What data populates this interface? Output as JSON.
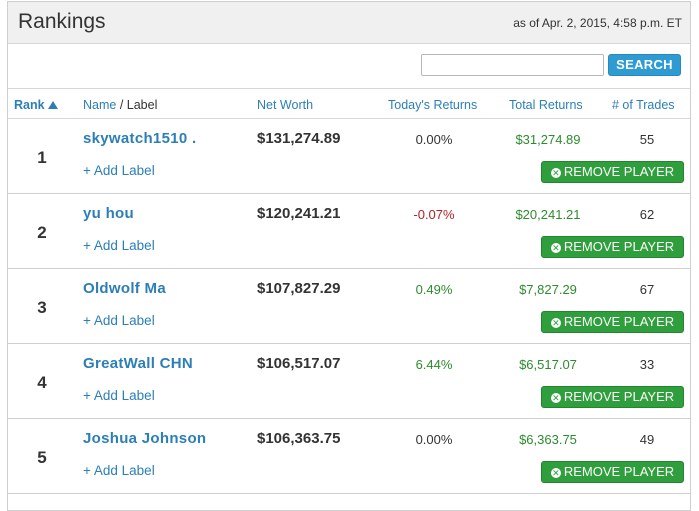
{
  "header": {
    "title": "Rankings",
    "as_of": "as of Apr. 2, 2015, 4:58 p.m. ET"
  },
  "search": {
    "placeholder": "",
    "value": "",
    "button_label": "SEARCH"
  },
  "columns": {
    "rank": "Rank",
    "name": "Name",
    "name_sep": " / ",
    "label": "Label",
    "net_worth": "Net Worth",
    "todays_returns": "Today's Returns",
    "total_returns": "Total Returns",
    "trades": "# of Trades"
  },
  "colors": {
    "link": "#2c7fb6",
    "positive": "#2e8b2e",
    "negative": "#b22222",
    "neutral": "#333333",
    "search_button": "#2e9bd3",
    "remove_button": "#2f9e3c"
  },
  "add_label_text": "+ Add Label",
  "remove_label": "REMOVE PLAYER",
  "rows": [
    {
      "rank": "1",
      "name": "skywatch1510 .",
      "net_worth": "$131,274.89",
      "today": "0.00%",
      "today_sign": "neutral",
      "total": "$31,274.89",
      "trades": "55"
    },
    {
      "rank": "2",
      "name": "yu hou",
      "net_worth": "$120,241.21",
      "today": "-0.07%",
      "today_sign": "negative",
      "total": "$20,241.21",
      "trades": "62"
    },
    {
      "rank": "3",
      "name": "Oldwolf Ma",
      "net_worth": "$107,827.29",
      "today": "0.49%",
      "today_sign": "positive",
      "total": "$7,827.29",
      "trades": "67"
    },
    {
      "rank": "4",
      "name": "GreatWall CHN",
      "net_worth": "$106,517.07",
      "today": "6.44%",
      "today_sign": "positive",
      "total": "$6,517.07",
      "trades": "33"
    },
    {
      "rank": "5",
      "name": "Joshua Johnson",
      "net_worth": "$106,363.75",
      "today": "0.00%",
      "today_sign": "neutral",
      "total": "$6,363.75",
      "trades": "49"
    }
  ]
}
